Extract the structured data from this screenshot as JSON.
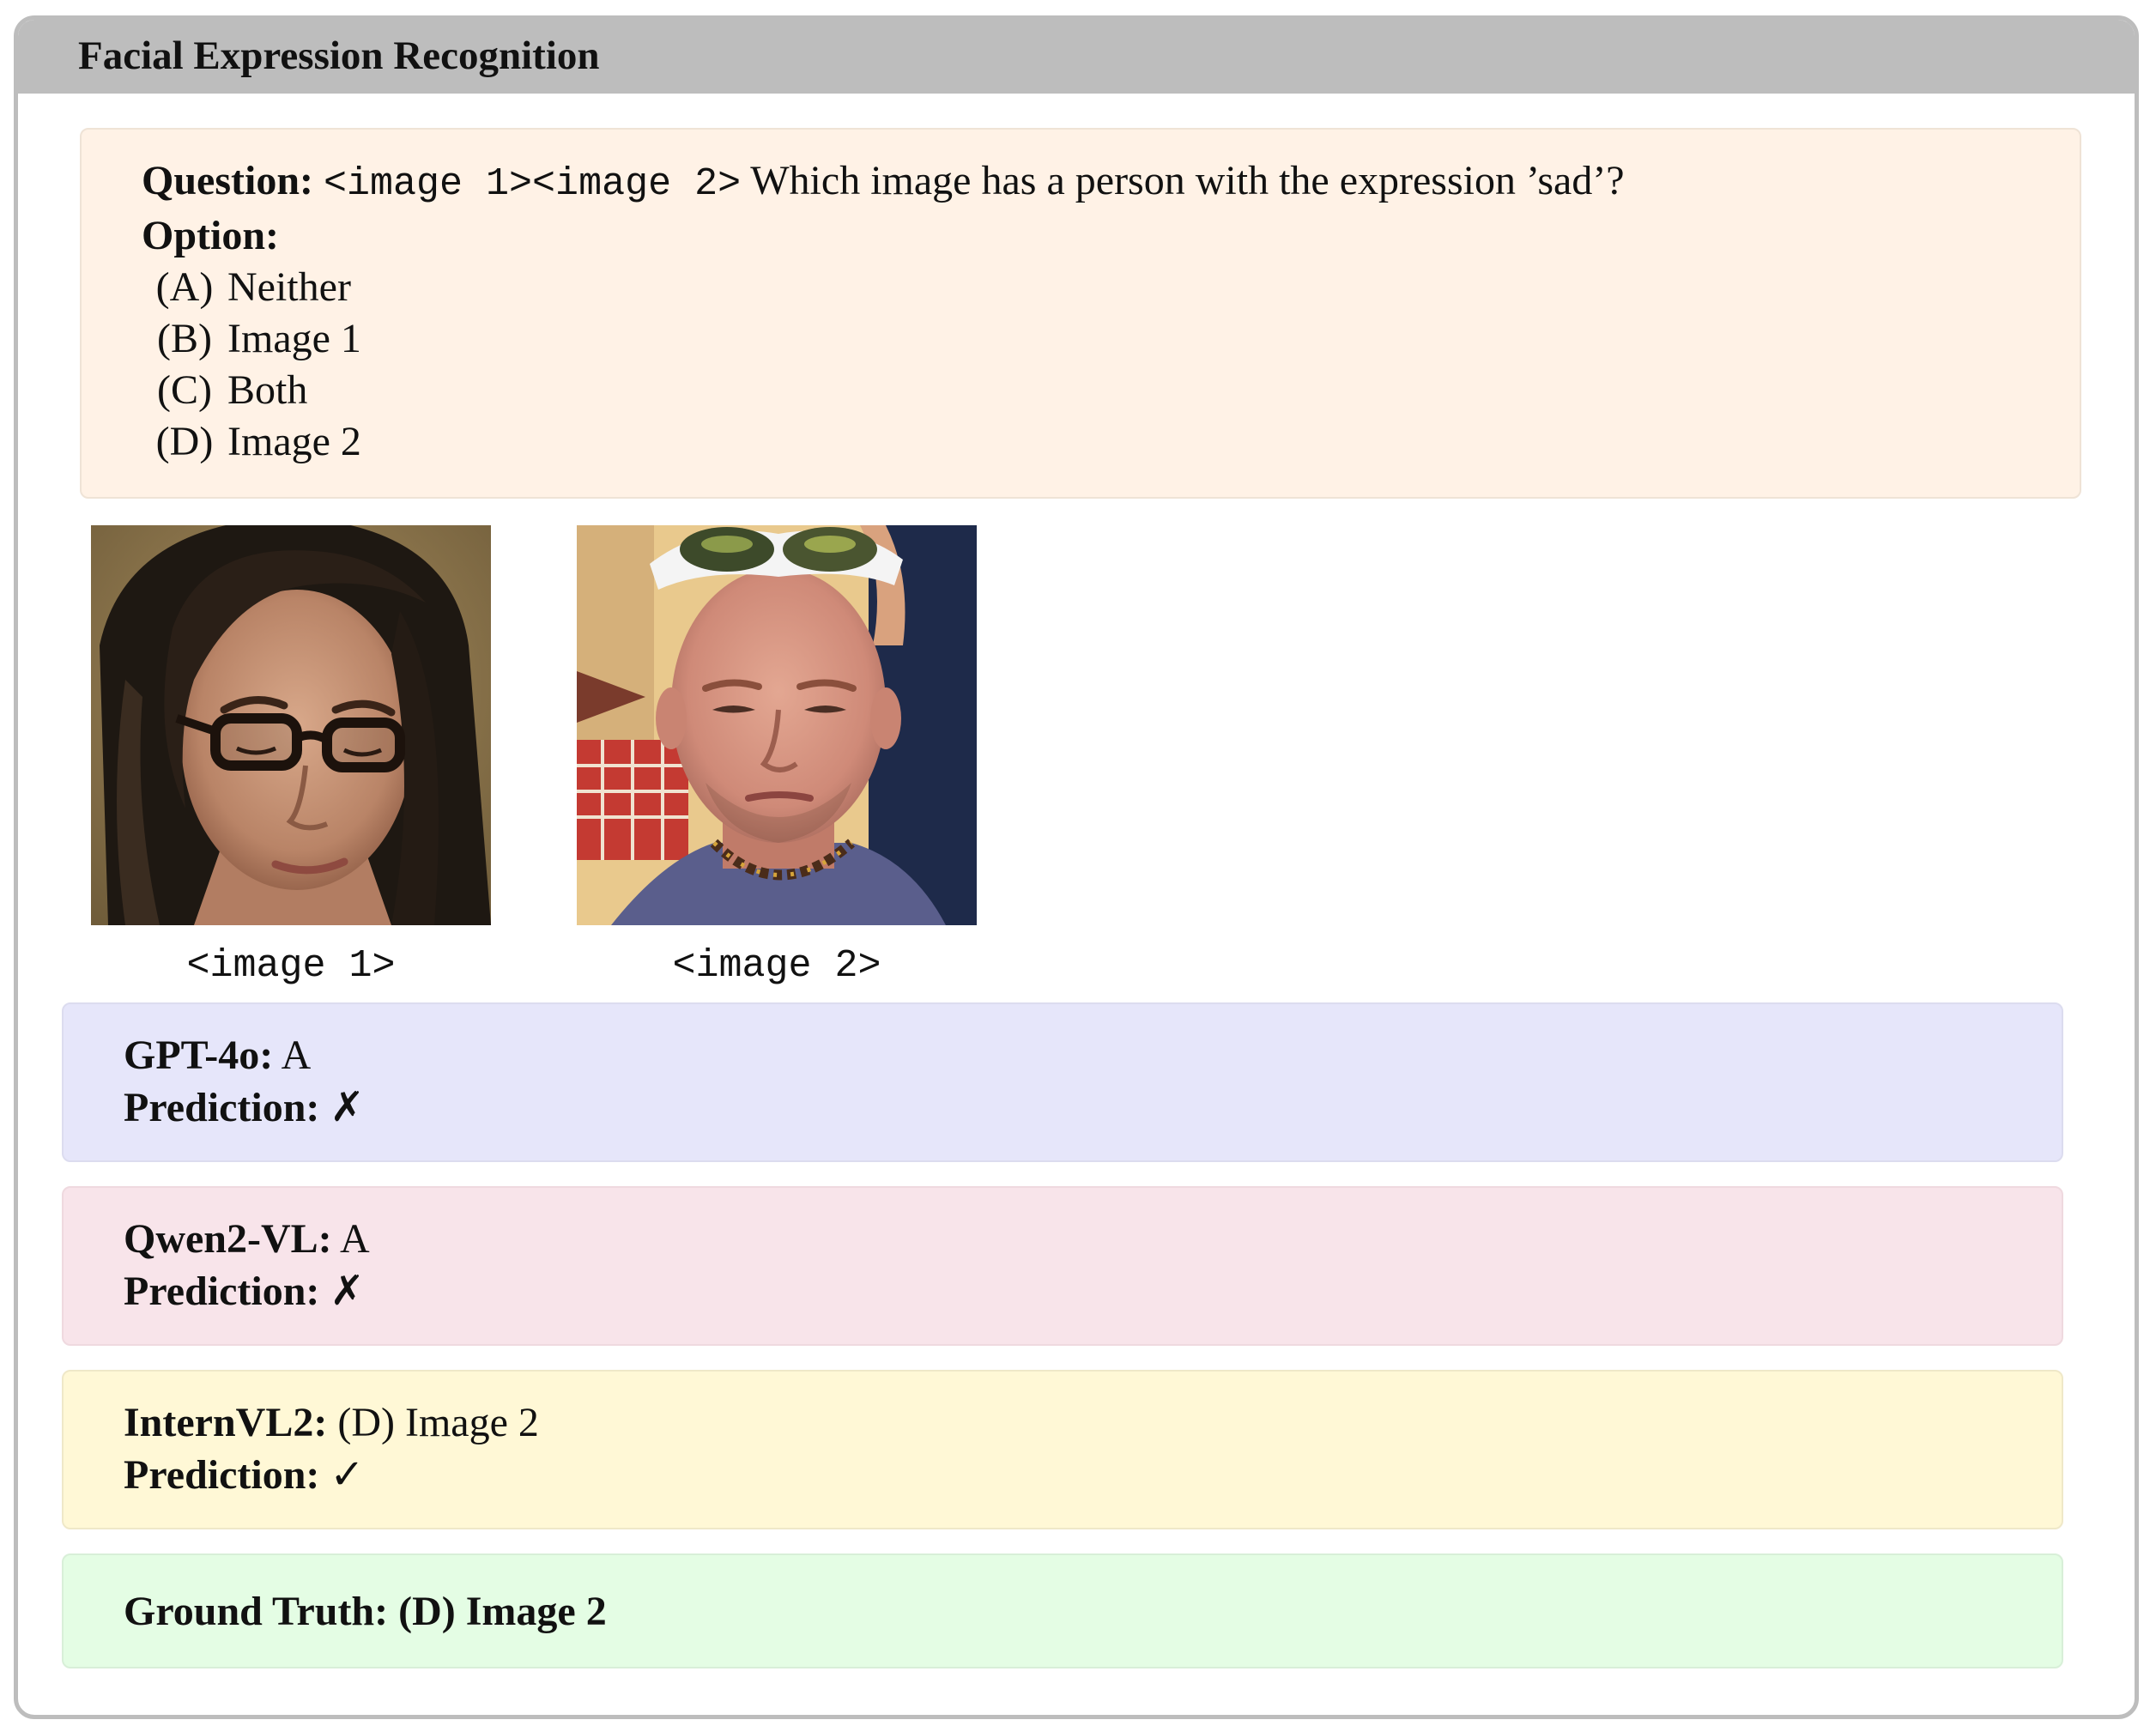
{
  "panel": {
    "title": "Facial Expression Recognition"
  },
  "question": {
    "label": "Question:",
    "image_tags": "<image 1><image 2>",
    "text": " Which image has a person with the expression ’sad’?",
    "option_label": "Option:",
    "options": [
      {
        "letter": "(A)",
        "text": "Neither"
      },
      {
        "letter": "(B)",
        "text": "Image 1"
      },
      {
        "letter": "(C)",
        "text": "Both"
      },
      {
        "letter": "(D)",
        "text": "Image 2"
      }
    ]
  },
  "images": [
    {
      "caption": "<image 1>",
      "subject": "woman with dark hair and glasses looking down"
    },
    {
      "caption": "<image 2>",
      "subject": "bald man with sunglasses on forehead"
    }
  ],
  "models": [
    {
      "name": "GPT-4o:",
      "answer": "A",
      "prediction_label": "Prediction:",
      "prediction_mark": "✗",
      "correct": false
    },
    {
      "name": "Qwen2-VL:",
      "answer": "A",
      "prediction_label": "Prediction:",
      "prediction_mark": "✗",
      "correct": false
    },
    {
      "name": "InternVL2:",
      "answer": "(D) Image 2",
      "prediction_label": "Prediction:",
      "prediction_mark": "✓",
      "correct": true
    }
  ],
  "ground_truth": {
    "label": "Ground Truth:",
    "answer": "(D) Image 2"
  },
  "colors": {
    "header": "#bdbdbd",
    "question_bg": "#fff2e6",
    "gpt_bg": "#e6e6fa",
    "qwen_bg": "#f8e4ea",
    "intern_bg": "#fff8d6",
    "gt_bg": "#e4fde4"
  }
}
